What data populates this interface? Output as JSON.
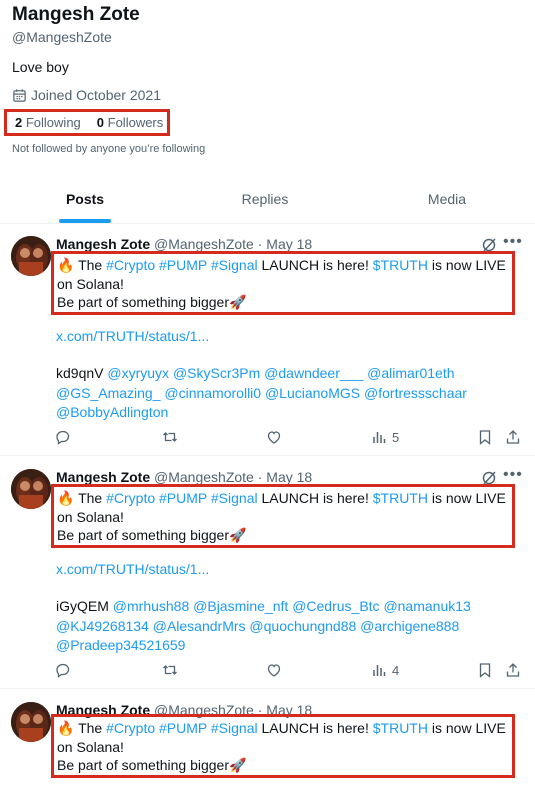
{
  "profile": {
    "display_name": "Mangesh Zote",
    "handle": "@MangeshZote",
    "bio": "Love boy",
    "joined": "Joined October 2021",
    "following_count": "2",
    "following_label": "Following",
    "followers_count": "0",
    "followers_label": "Followers",
    "not_followed": "Not followed by anyone you’re following"
  },
  "tabs": [
    {
      "label": "Posts",
      "active": true
    },
    {
      "label": "Replies",
      "active": false
    },
    {
      "label": "Media",
      "active": false
    }
  ],
  "posts": [
    {
      "author": "Mangesh Zote",
      "meta": "@MangeshZote · May 18",
      "emoji_start": "🔥",
      "text_the": "The",
      "tags": [
        "#Crypto",
        "#PUMP",
        "#Signal"
      ],
      "text_launch": "LAUNCH is here!",
      "ticker": "$TRUTH",
      "text_live": "is now LIVE on Solana!",
      "line2": "Be part of something bigger",
      "emoji_end": "🚀",
      "link": "x.com/TRUTH/status/1...",
      "code": "kd9qnV",
      "mentions": [
        "@xyryuyx",
        "@SkyScr3Pm",
        "@dawndeer___",
        "@alimar01eth",
        "@GS_Amazing_",
        "@cinnamorolli0",
        "@LucianoMGS",
        "@fortressschaar",
        "@BobbyAdlington"
      ],
      "views": "5"
    },
    {
      "author": "Mangesh Zote",
      "meta": "@MangeshZote · May 18",
      "emoji_start": "🔥",
      "text_the": "The",
      "tags": [
        "#Crypto",
        "#PUMP",
        "#Signal"
      ],
      "text_launch": "LAUNCH is here!",
      "ticker": "$TRUTH",
      "text_live": "is now LIVE on Solana!",
      "line2": "Be part of something bigger",
      "emoji_end": "🚀",
      "link": "x.com/TRUTH/status/1...",
      "code": "iGyQEM",
      "mentions": [
        "@mrhush88",
        "@Bjasmine_nft",
        "@Cedrus_Btc",
        "@namanuk13",
        "@KJ49268134",
        "@AlesandrMrs",
        "@quochungnd88",
        "@archigene888",
        "@Pradeep34521659"
      ],
      "views": "4"
    },
    {
      "author": "Mangesh Zote",
      "meta": "@MangeshZote · May 18",
      "emoji_start": "🔥",
      "text_the": "The",
      "tags": [
        "#Crypto",
        "#PUMP",
        "#Signal"
      ],
      "text_launch": "LAUNCH is here!",
      "ticker": "$TRUTH",
      "text_live": "is now LIVE on Solana!",
      "line2": "Be part of something bigger",
      "emoji_end": "🚀"
    }
  ],
  "colors": {
    "accent": "#1d9bf0",
    "highlight_box": "#d52a1e",
    "text": "#0f1419",
    "secondary": "#536471"
  },
  "icons": [
    "calendar-icon",
    "grok-icon",
    "more-icon",
    "reply-icon",
    "repost-icon",
    "like-icon",
    "views-icon",
    "bookmark-icon",
    "share-icon"
  ]
}
